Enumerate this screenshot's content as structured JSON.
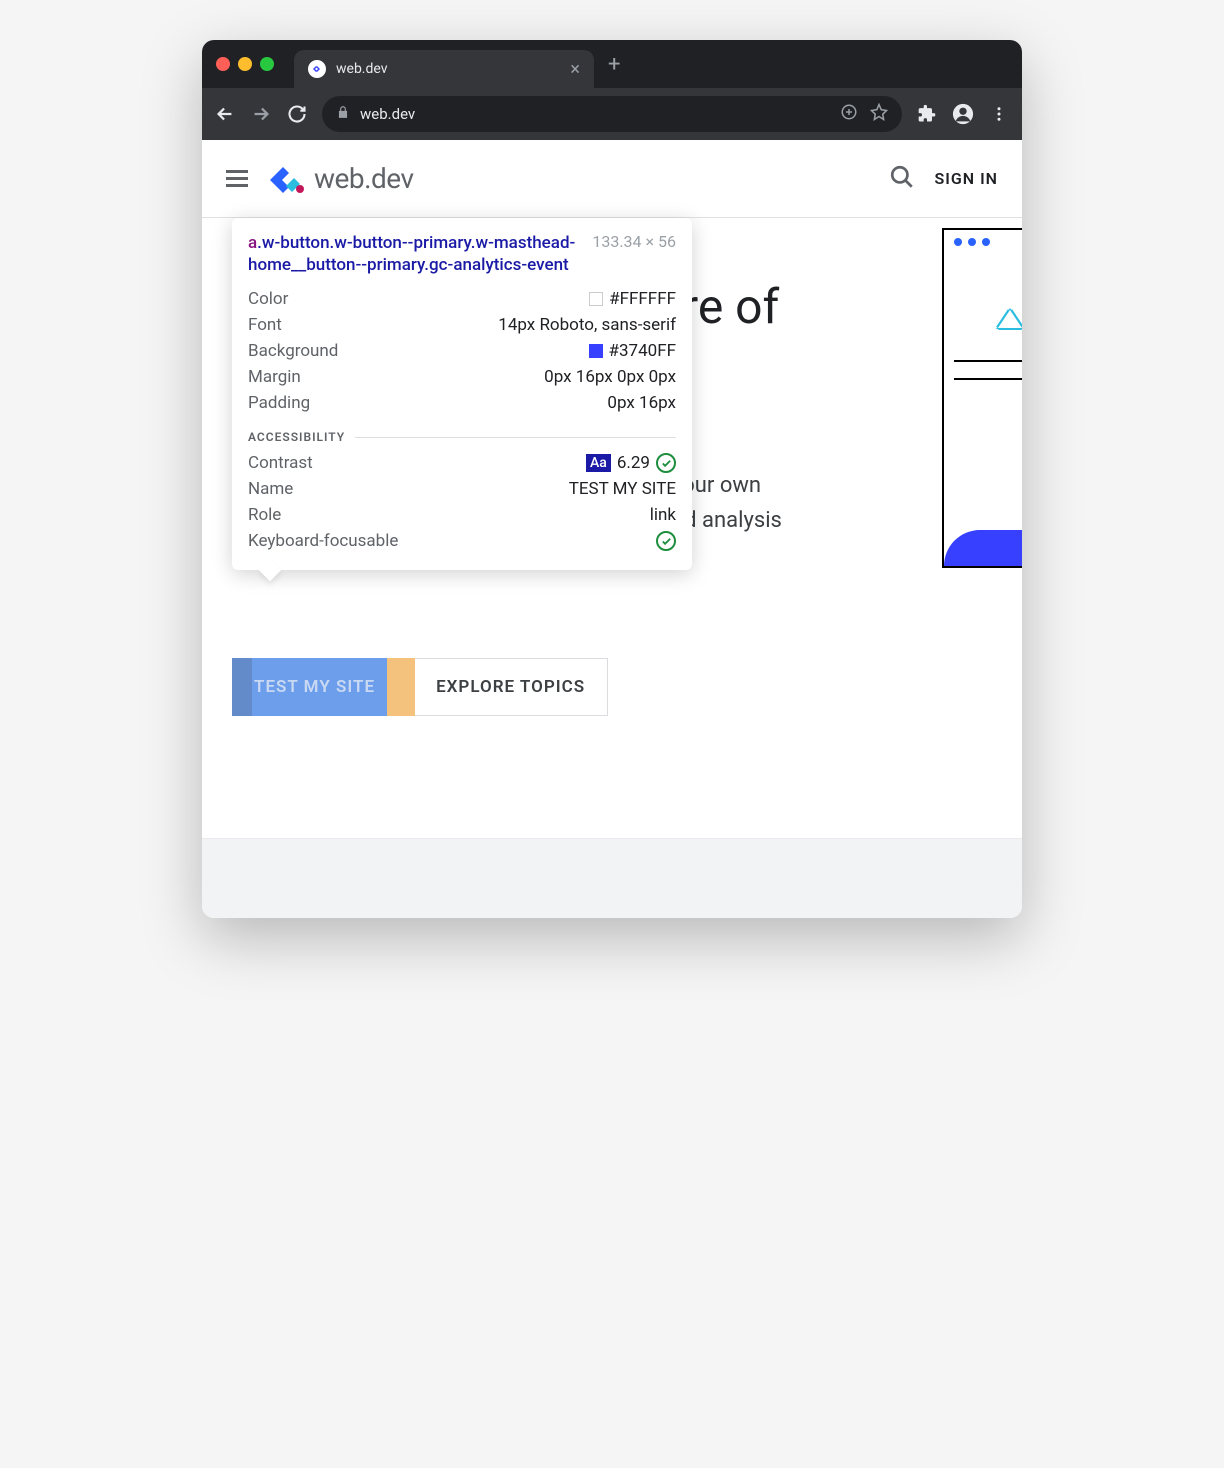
{
  "browser": {
    "tab_title": "web.dev",
    "url": "web.dev"
  },
  "header": {
    "logo_text": "web.dev",
    "signin": "SIGN IN"
  },
  "hero": {
    "title_fragment": "re of",
    "text_line1": "your own",
    "text_line2": "nd analysis"
  },
  "buttons": {
    "primary": "TEST MY SITE",
    "secondary": "EXPLORE TOPICS"
  },
  "tooltip": {
    "tag": "a",
    "selector_rest": ".w-button.w-button--primary.w-masthead-home__button--primary.gc-analytics-event",
    "dimensions": "133.34 × 56",
    "rows": {
      "color_label": "Color",
      "color_value": "#FFFFFF",
      "font_label": "Font",
      "font_value": "14px Roboto, sans-serif",
      "bg_label": "Background",
      "bg_value": "#3740FF",
      "margin_label": "Margin",
      "margin_value": "0px 16px 0px 0px",
      "padding_label": "Padding",
      "padding_value": "0px 16px"
    },
    "a11y_header": "ACCESSIBILITY",
    "a11y": {
      "contrast_label": "Contrast",
      "contrast_badge": "Aa",
      "contrast_value": "6.29",
      "name_label": "Name",
      "name_value": "TEST MY SITE",
      "role_label": "Role",
      "role_value": "link",
      "kb_label": "Keyboard-focusable"
    }
  }
}
